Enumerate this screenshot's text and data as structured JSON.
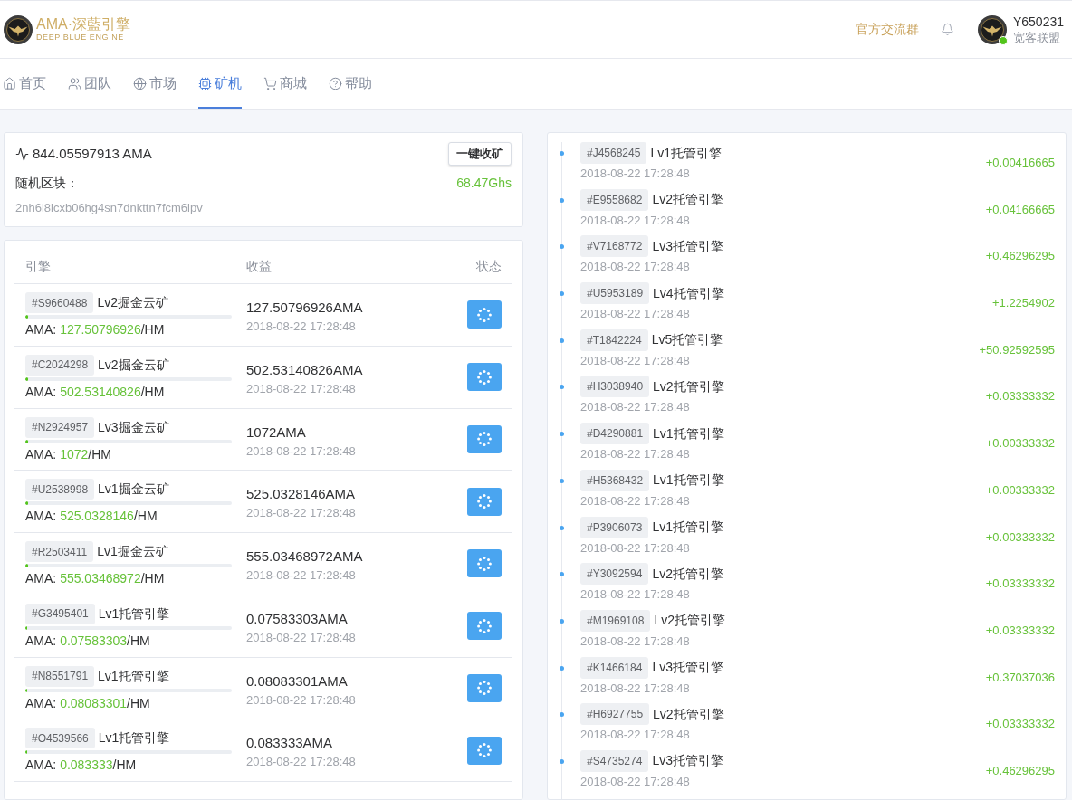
{
  "header": {
    "logo": {
      "title": "AMA·深藍引擎",
      "subtitle": "DEEP BLUE ENGINE"
    },
    "group_link": "官方交流群",
    "user": {
      "name": "Y650231",
      "group": "宽客联盟",
      "online": true
    }
  },
  "nav": [
    {
      "label": "首页",
      "selected": false
    },
    {
      "label": "团队",
      "selected": false
    },
    {
      "label": "市场",
      "selected": false
    },
    {
      "label": "矿机",
      "selected": true
    },
    {
      "label": "商城",
      "selected": false
    },
    {
      "label": "帮助",
      "selected": false
    }
  ],
  "summary": {
    "balance": "844.05597913 AMA",
    "collect_button": "一键收矿",
    "block_label": "随机区块：",
    "hashrate": "68.47Ghs",
    "block_hash": "2nh6l8icxb06hg4sn7dnkttn7fcm6lpv"
  },
  "engines": {
    "columns": [
      "引擎",
      "收益",
      "状态"
    ],
    "rows": [
      {
        "id": "#S9660488",
        "name": "Lv2掘金云矿",
        "level": 0.015,
        "rate_label": "AMA:",
        "rate": "127.50796926/HM",
        "earnings": "127.50796926AMA",
        "time": "2018-08-22 17:28:48"
      },
      {
        "id": "#C2024298",
        "name": "Lv2掘金云矿",
        "level": 0.015,
        "rate_label": "AMA:",
        "rate": "502.53140826/HM",
        "earnings": "502.53140826AMA",
        "time": "2018-08-22 17:28:48"
      },
      {
        "id": "#N2924957",
        "name": "Lv3掘金云矿",
        "level": 0.015,
        "rate_label": "AMA:",
        "rate": "1072/HM",
        "earnings": "1072AMA",
        "time": "2018-08-22 17:28:48"
      },
      {
        "id": "#U2538998",
        "name": "Lv1掘金云矿",
        "level": 0.015,
        "rate_label": "AMA:",
        "rate": "525.0328146/HM",
        "earnings": "525.0328146AMA",
        "time": "2018-08-22 17:28:48"
      },
      {
        "id": "#R2503411",
        "name": "Lv1掘金云矿",
        "level": 0.015,
        "rate_label": "AMA:",
        "rate": "555.03468972/HM",
        "earnings": "555.03468972AMA",
        "time": "2018-08-22 17:28:48"
      },
      {
        "id": "#G3495401",
        "name": "Lv1托管引擎",
        "level": 0.01,
        "rate_label": "AMA:",
        "rate": "0.07583303/HM",
        "earnings": "0.07583303AMA",
        "time": "2018-08-22 17:28:48"
      },
      {
        "id": "#N8551791",
        "name": "Lv1托管引擎",
        "level": 0.01,
        "rate_label": "AMA:",
        "rate": "0.08083301/HM",
        "earnings": "0.08083301AMA",
        "time": "2018-08-22 17:28:48"
      },
      {
        "id": "#O4539566",
        "name": "Lv1托管引擎",
        "level": 0.01,
        "rate_label": "AMA:",
        "rate": "0.083333/HM",
        "earnings": "0.083333AMA",
        "time": "2018-08-22 17:28:48"
      }
    ]
  },
  "earnings_log": [
    {
      "id": "#J4568245",
      "name": "Lv1托管引擎",
      "time": "2018-08-22 17:28:48",
      "amount": "+0.00416665"
    },
    {
      "id": "#E9558682",
      "name": "Lv2托管引擎",
      "time": "2018-08-22 17:28:48",
      "amount": "+0.04166665"
    },
    {
      "id": "#V7168772",
      "name": "Lv3托管引擎",
      "time": "2018-08-22 17:28:48",
      "amount": "+0.46296295"
    },
    {
      "id": "#U5953189",
      "name": "Lv4托管引擎",
      "time": "2018-08-22 17:28:48",
      "amount": "+1.2254902"
    },
    {
      "id": "#T1842224",
      "name": "Lv5托管引擎",
      "time": "2018-08-22 17:28:48",
      "amount": "+50.92592595"
    },
    {
      "id": "#H3038940",
      "name": "Lv2托管引擎",
      "time": "2018-08-22 17:28:48",
      "amount": "+0.03333332"
    },
    {
      "id": "#D4290881",
      "name": "Lv1托管引擎",
      "time": "2018-08-22 17:28:48",
      "amount": "+0.00333332"
    },
    {
      "id": "#H5368432",
      "name": "Lv1托管引擎",
      "time": "2018-08-22 17:28:48",
      "amount": "+0.00333332"
    },
    {
      "id": "#P3906073",
      "name": "Lv1托管引擎",
      "time": "2018-08-22 17:28:48",
      "amount": "+0.00333332"
    },
    {
      "id": "#Y3092594",
      "name": "Lv2托管引擎",
      "time": "2018-08-22 17:28:48",
      "amount": "+0.03333332"
    },
    {
      "id": "#M1969108",
      "name": "Lv2托管引擎",
      "time": "2018-08-22 17:28:48",
      "amount": "+0.03333332"
    },
    {
      "id": "#K1466184",
      "name": "Lv3托管引擎",
      "time": "2018-08-22 17:28:48",
      "amount": "+0.37037036"
    },
    {
      "id": "#H6927755",
      "name": "Lv2托管引擎",
      "time": "2018-08-22 17:28:48",
      "amount": "+0.03333332"
    },
    {
      "id": "#S4735274",
      "name": "Lv3托管引擎",
      "time": "2018-08-22 17:28:48",
      "amount": "+0.46296295"
    }
  ]
}
